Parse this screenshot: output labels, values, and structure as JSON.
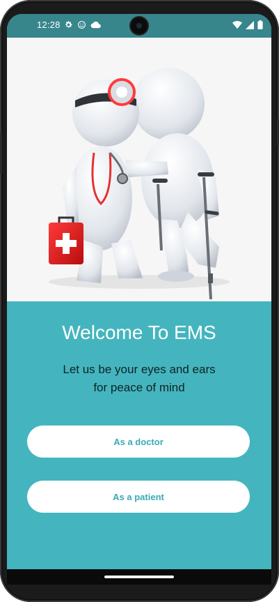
{
  "status_bar": {
    "time": "12:28",
    "icons_left": [
      "settings-icon",
      "smiley-icon",
      "cloud-icon"
    ],
    "icons_right": [
      "wifi-icon",
      "signal-icon",
      "battery-icon"
    ]
  },
  "hero": {
    "image": "doctor-helping-patient-illustration"
  },
  "welcome": {
    "title": "Welcome To EMS",
    "subtitle_line1": "Let us be your eyes and ears",
    "subtitle_line2": "for peace of mind"
  },
  "actions": {
    "doctor_label": "As a doctor",
    "patient_label": "As a patient"
  },
  "colors": {
    "accent": "#44b5be",
    "status_bar": "#37868c",
    "button_text": "#3aaab4"
  }
}
